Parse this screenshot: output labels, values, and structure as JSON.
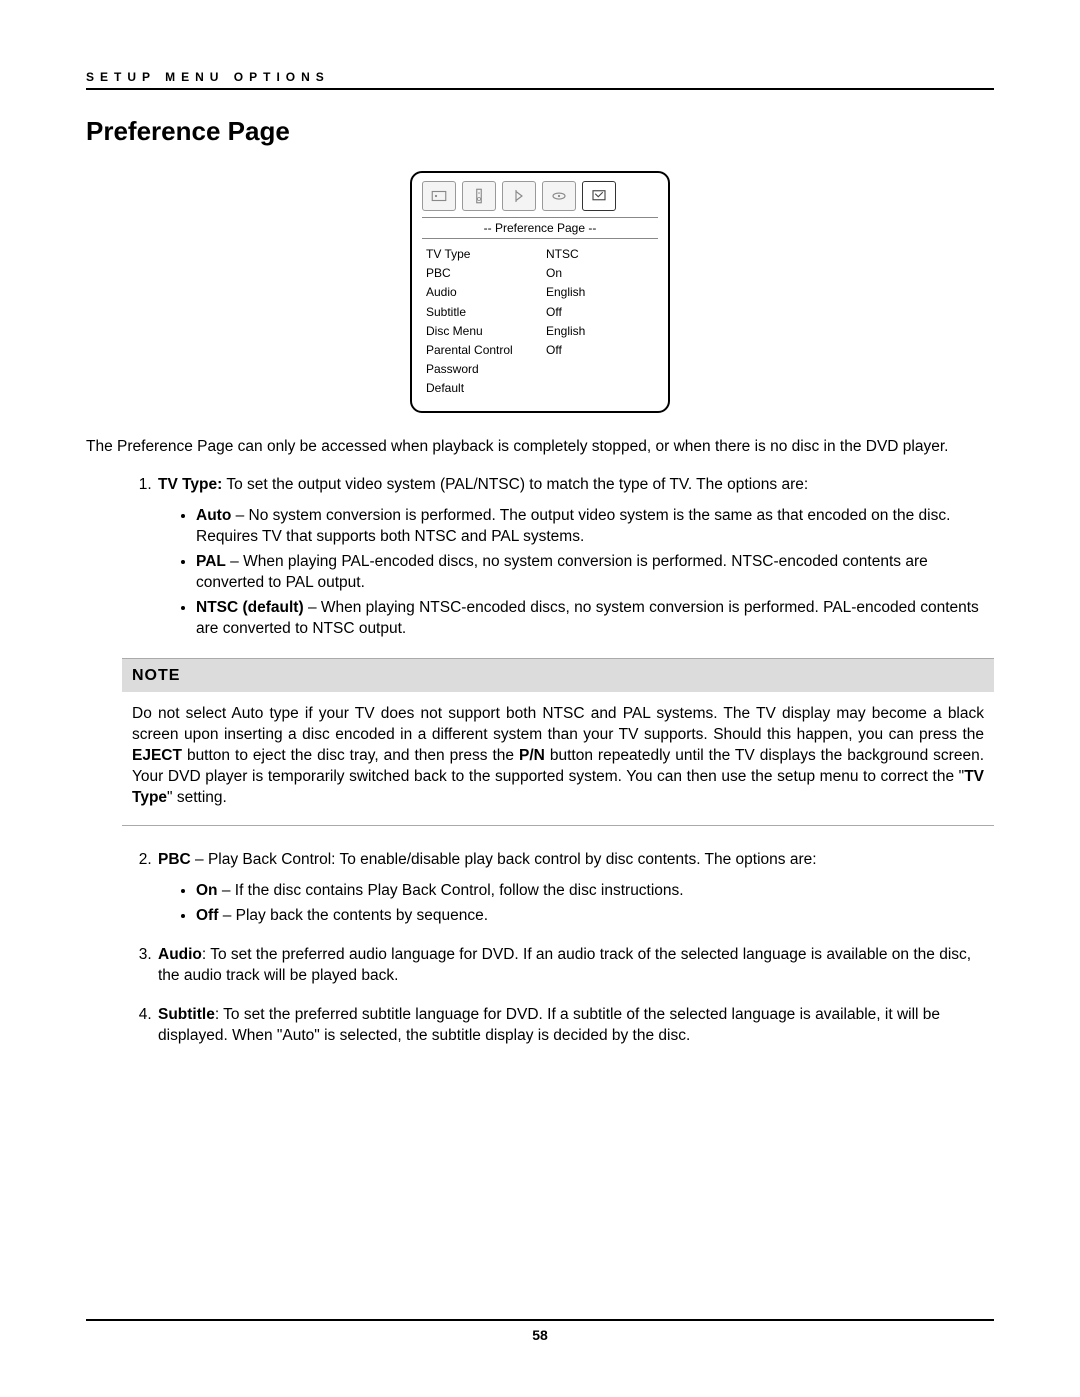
{
  "header": "SETUP MENU OPTIONS",
  "title": "Preference Page",
  "menu": {
    "title": "-- Preference Page --",
    "rows": [
      {
        "key": "TV Type",
        "val": "NTSC"
      },
      {
        "key": "PBC",
        "val": "On"
      },
      {
        "key": "Audio",
        "val": "English"
      },
      {
        "key": "Subtitle",
        "val": "Off"
      },
      {
        "key": "Disc Menu",
        "val": "English"
      },
      {
        "key": "Parental Control",
        "val": "Off"
      },
      {
        "key": "Password",
        "val": ""
      },
      {
        "key": "Default",
        "val": ""
      }
    ]
  },
  "intro": "The Preference Page can only be accessed when playback is completely stopped, or when there is no disc in the DVD player.",
  "item1": {
    "lead_b": "TV Type:",
    "lead_rest": " To set the output video system (PAL/NTSC) to match the type of TV.  The options are:",
    "b1_b": "Auto",
    "b1_rest": " – No system conversion is performed.  The output video system is the same as that encoded on the disc.  Requires TV that supports both NTSC and PAL systems.",
    "b2_b": "PAL",
    "b2_rest": " – When playing PAL-encoded discs, no system conversion is performed.  NTSC-encoded contents are converted to PAL output.",
    "b3_b": "NTSC (default)",
    "b3_rest": " – When playing NTSC-encoded discs, no system conversion is performed. PAL-encoded contents are converted to NTSC output."
  },
  "note": {
    "heading": "NOTE",
    "p1": "Do not select Auto type if your TV does not support both NTSC and PAL systems.  The TV display may become a black screen upon inserting a disc encoded in a different system than your TV supports. Should this happen, you can press the ",
    "eject": "EJECT",
    "p2": " button to eject the disc tray, and then press the ",
    "pn": "P/N",
    "p3": " button repeatedly until the TV displays the background screen.  Your DVD player is temporarily switched back to the supported system.  You can then use the setup menu to correct the \"",
    "tvtype": "TV Type",
    "p4": "\" setting."
  },
  "item2": {
    "lead_b": "PBC",
    "lead_rest": " – Play Back Control:  To enable/disable play back control by disc contents.   The options are:",
    "b1_b": "On",
    "b1_rest": " – If the disc contains Play Back Control, follow the disc instructions.",
    "b2_b": "Off",
    "b2_rest": " – Play back the contents by sequence."
  },
  "item3": {
    "lead_b": "Audio",
    "lead_rest": ": To set the preferred audio language for DVD.  If an audio track of the selected language is available on the disc, the audio track will be played back."
  },
  "item4": {
    "lead_b": "Subtitle",
    "lead_rest": ": To set the preferred subtitle language for DVD.  If a subtitle of the selected language is available, it will be displayed.  When \"Auto\" is selected, the subtitle display is decided by the disc."
  },
  "page_number": "58"
}
